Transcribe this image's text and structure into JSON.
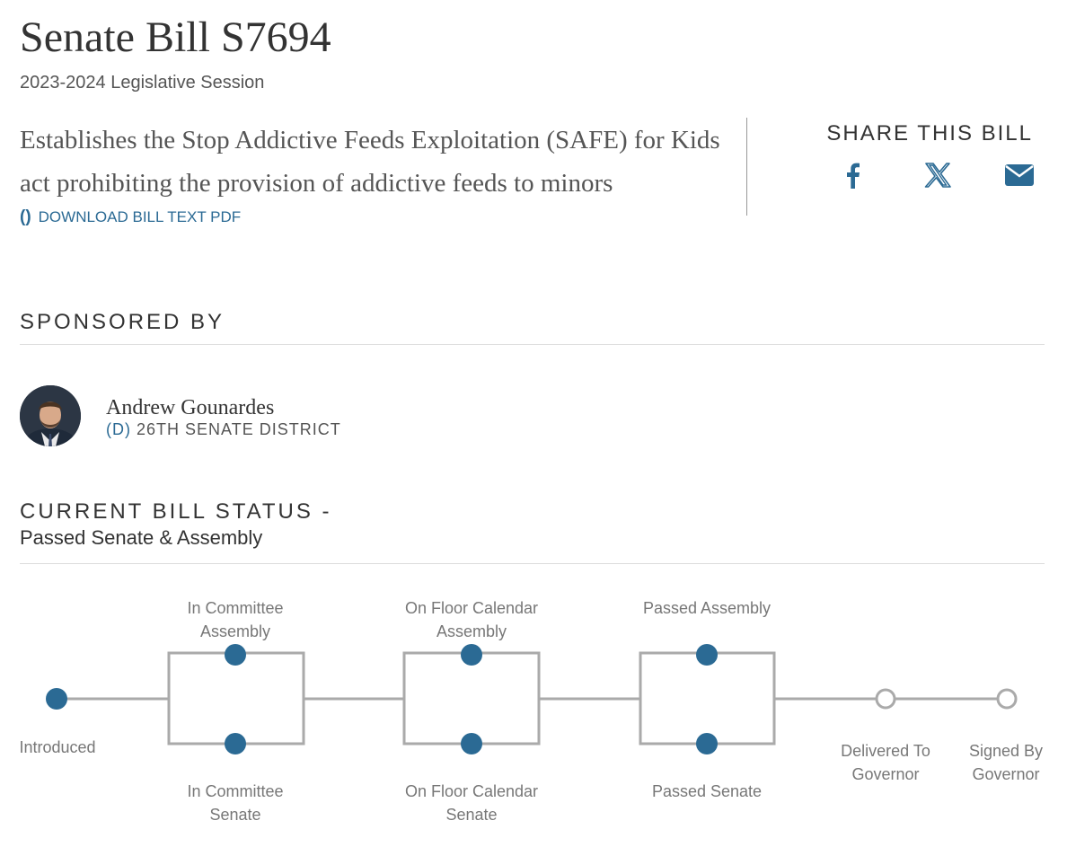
{
  "bill": {
    "title": "Senate Bill S7694",
    "session": "2023-2024 Legislative Session",
    "summary": "Establishes the Stop Addictive Feeds Exploitation (SAFE) for Kids act prohibiting the provision of addictive feeds to minors",
    "download_icon": "()",
    "download_label": "DOWNLOAD BILL TEXT PDF"
  },
  "share": {
    "heading": "SHARE THIS BILL",
    "icons": [
      "facebook-icon",
      "x-icon",
      "email-icon"
    ]
  },
  "sponsored": {
    "heading": "SPONSORED BY",
    "name": "Andrew Gounardes",
    "party": "(D)",
    "district": "26TH SENATE DISTRICT"
  },
  "status": {
    "heading": "CURRENT BILL STATUS -",
    "current": "Passed Senate & Assembly",
    "steps": {
      "introduced": "Introduced",
      "committee_assembly": [
        "In Committee",
        "Assembly"
      ],
      "committee_senate": [
        "In Committee",
        "Senate"
      ],
      "floor_assembly": [
        "On Floor Calendar",
        "Assembly"
      ],
      "floor_senate": [
        "On Floor Calendar",
        "Senate"
      ],
      "passed_assembly": "Passed Assembly",
      "passed_senate": "Passed Senate",
      "delivered": [
        "Delivered To",
        "Governor"
      ],
      "signed": [
        "Signed By",
        "Governor"
      ]
    }
  },
  "colors": {
    "accent": "#2b6a94",
    "completed_dot": "#2b6a94",
    "pending_dot": "#ffffff",
    "line": "#aaaaaa"
  }
}
